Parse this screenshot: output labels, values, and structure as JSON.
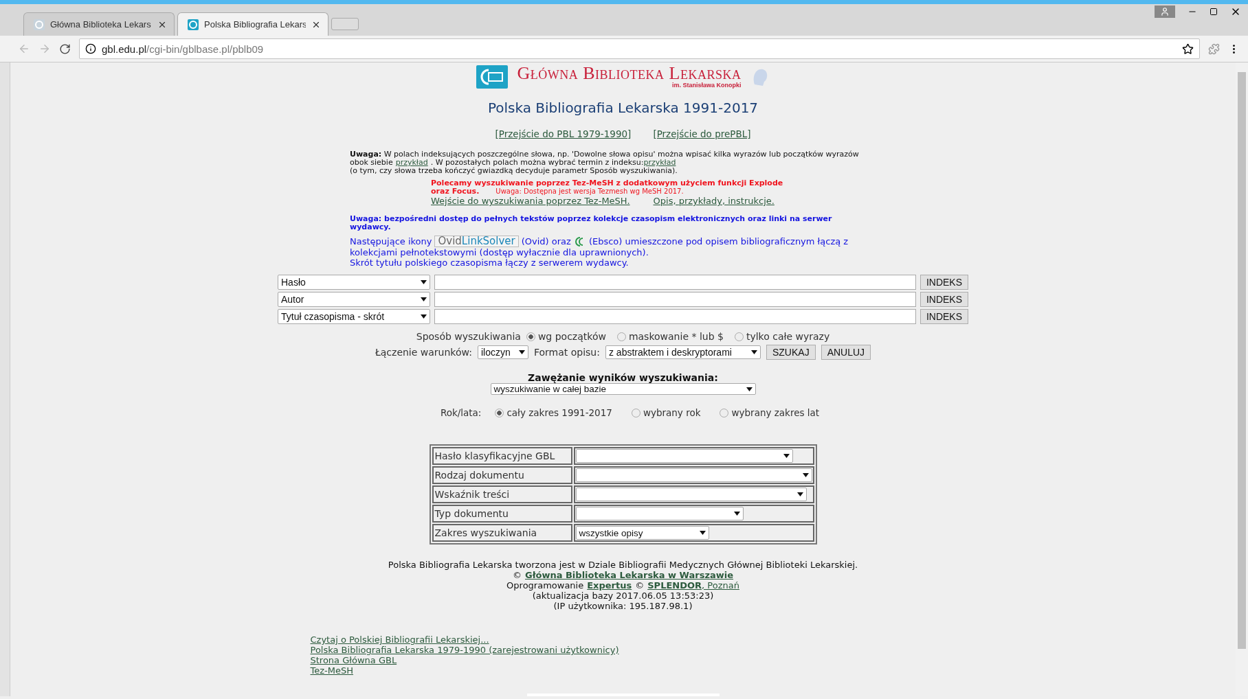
{
  "browser": {
    "tabs": [
      {
        "title": "Główna Biblioteka Lekars",
        "selected": false
      },
      {
        "title": "Polska Bibliografia Lekars",
        "selected": true
      }
    ],
    "address": {
      "host": "gbl.edu.pl",
      "path": "/cgi-bin/gblbase.pl/pblb09"
    }
  },
  "logo": {
    "title": "Główna Biblioteka Lekarska",
    "subtitle": "im. Stanisława Konopki"
  },
  "heading": "Polska Bibliografia Lekarska 1991-2017",
  "top_links": [
    "[Przejście do PBL 1979-1990]",
    "[Przejście do prePBL]"
  ],
  "note": {
    "lines": [
      [
        {
          "kind": "text",
          "text": "**Uwaga:** W polach indeksujących poszczególne słowa, np. 'Dowolne słowa opisu' można wpisać kilka wyrazów lub początków wyrazów"
        }
      ],
      [
        {
          "kind": "text",
          "text": "obok siebie"
        },
        {
          "kind": "link",
          "text": "przykład"
        },
        {
          "kind": "text",
          "text": ". W pozostałych polach można wybrać termin z indeksu:"
        },
        {
          "kind": "link",
          "text": "przykład"
        }
      ],
      [
        {
          "kind": "text",
          "text": "(o tym, czy słowa trzeba kończyć gwiazdką decyduje parametr Sposób wyszukiwania)."
        }
      ]
    ]
  },
  "recommend": {
    "text": "Polecamy wyszukiwanie poprzez Tez-MeSH z dodatkowym użyciem funkcji Explode oraz Focus.",
    "remark": "Uwaga: Dostępna jest wersja Tezmesh wg MeSH 2017.",
    "links": [
      "Wejście do wyszukiwania poprzez Tez-MeSH.",
      "Opis, przykłady, instrukcje."
    ]
  },
  "access_note": "Uwaga: bezpośredni dostęp do pełnych tekstów poprzez kolekcje czasopism elektronicznych oraz linki na serwer wydawcy.",
  "icons_note": {
    "before": "Następujące ikony",
    "ovid_badge": {
      "left": "Ovid",
      "right": "LinkSolver"
    },
    "middle": "(Ovid) oraz",
    "after": "(Ebsco) umieszczone pod opisem bibliograficznym łączą z",
    "after2": "kolekcjami pełnotekstowymi (dostęp wyłacznie dla uprawnionych).",
    "last": "Skrót tytułu polskiego czasopisma łączy z serwerem wydawcy."
  },
  "search_rows": [
    {
      "field": "Hasło",
      "button": "INDEKS"
    },
    {
      "field": "Autor",
      "button": "INDEKS"
    },
    {
      "field": "Tytuł czasopisma - skrót",
      "button": "INDEKS"
    }
  ],
  "search_mode": {
    "label": "Sposób wyszukiwania",
    "options": [
      {
        "label": "wg początków",
        "selected": true
      },
      {
        "label": "maskowanie * lub $",
        "selected": false
      },
      {
        "label": "tylko całe wyrazy",
        "selected": false
      }
    ]
  },
  "combine": {
    "label": "Łączenie warunków:",
    "value": "iloczyn"
  },
  "format": {
    "label": "Format opisu:",
    "value": "z abstraktem i deskryptorami"
  },
  "actions": [
    "SZUKAJ",
    "ANULUJ"
  ],
  "narrowing": {
    "heading": "Zawężanie wyników wyszukiwania:",
    "value": "wyszukiwanie w całej bazie"
  },
  "years": {
    "label": "Rok/lata:",
    "options": [
      {
        "label": "cały zakres 1991-2017",
        "selected": true
      },
      {
        "label": "wybrany rok",
        "selected": false
      },
      {
        "label": "wybrany zakres lat",
        "selected": false
      }
    ]
  },
  "filters": [
    {
      "label": "Hasło klasyfikacyjne GBL"
    },
    {
      "label": "Rodzaj dokumentu"
    },
    {
      "label": "Wskaźnik treści"
    },
    {
      "label": "Typ dokumentu"
    },
    {
      "label": "Zakres wyszukiwania",
      "value": "wszystkie opisy"
    }
  ],
  "footer": {
    "line1": "Polska Bibliografia Lekarska tworzona jest w Dziale Bibliografii Medycznych Głównej Biblioteki Lekarskiej.",
    "copyright": "©",
    "owner_link": "Główna Biblioteka Lekarska w Warszawie",
    "software": "Oprogramowanie",
    "software_link": "Expertus",
    "copy2": "©",
    "vendor_link": "SPLENDOR",
    "city_link": ", Poznań",
    "update": "(aktualizacja bazy 2017.06.05 13:53:23)",
    "ip": "(IP użytkownika: 195.187.98.1)"
  },
  "bottom_links": [
    "Czytaj o Polskiej Bibliografii Lekarskiej...",
    "Polska Bibliografia Lekarska 1979-1990 (zarejestrowani użytkownicy)",
    "Strona Główna GBL",
    "Tez-MeSH"
  ]
}
